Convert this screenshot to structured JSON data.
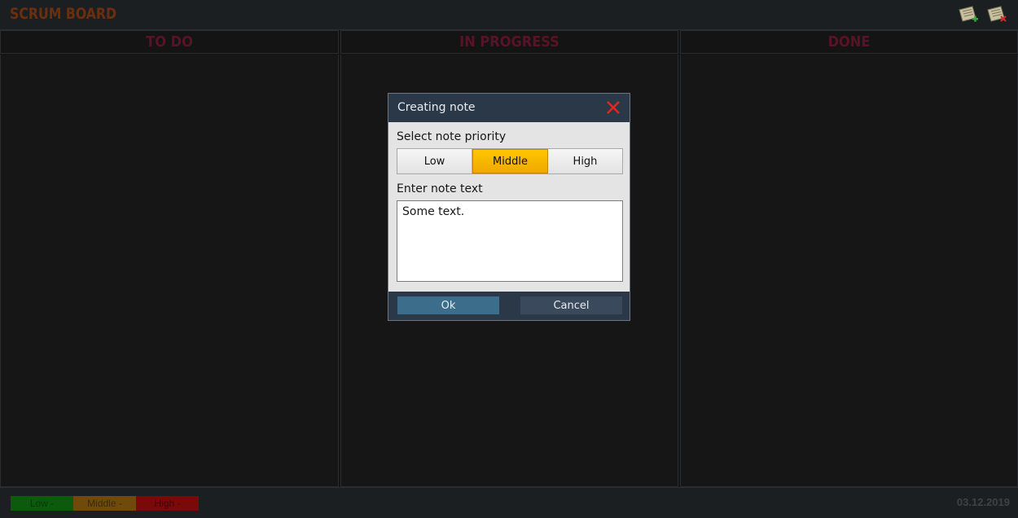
{
  "app": {
    "title": "SCRUM BOARD",
    "add_note_icon": "note-add-icon",
    "delete_note_icon": "note-delete-icon"
  },
  "columns": [
    {
      "label": "TO DO"
    },
    {
      "label": "IN PROGRESS"
    },
    {
      "label": "DONE"
    }
  ],
  "dialog": {
    "title": "Creating note",
    "close_icon": "close-icon",
    "priority_label": "Select note priority",
    "priorities": [
      "Low",
      "Middle",
      "High"
    ],
    "selected_priority": "Middle",
    "text_label": "Enter note text",
    "text_value": "Some text.",
    "ok_label": "Ok",
    "cancel_label": "Cancel"
  },
  "legend": [
    {
      "label": "Low -",
      "color": "#0c5a0c"
    },
    {
      "label": "Middle -",
      "color": "#6f4a0a"
    },
    {
      "label": "High -",
      "color": "#7a0a0a"
    }
  ],
  "status": {
    "date": "03.12.2019"
  },
  "colors": {
    "background": "#151515",
    "header_bar": "#2b3848",
    "accent_selected": "#ffc600",
    "close_red": "#e0281e"
  }
}
